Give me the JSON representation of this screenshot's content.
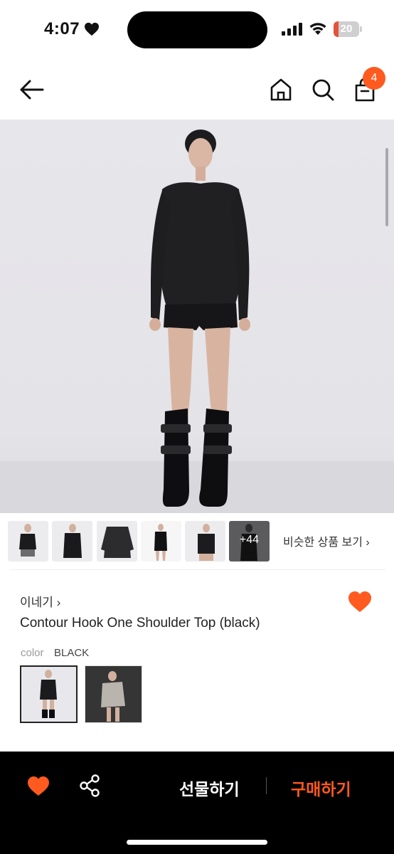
{
  "status": {
    "time": "4:07",
    "battery_level": "20",
    "battery_fraction": 0.2
  },
  "header": {
    "cart_count": "4",
    "icons": [
      "back-arrow-icon",
      "home-icon",
      "search-icon",
      "shopping-bag-icon"
    ]
  },
  "gallery": {
    "thumbnail_count_visible": 6,
    "more_label": "+44",
    "similar_label": "비슷한 상품 보기 ›"
  },
  "product": {
    "brand": "이네기 ›",
    "name": "Contour Hook One Shoulder Top (black)",
    "color_label": "color",
    "color_value": "BLACK",
    "wishlisted": true
  },
  "bottom_bar": {
    "gift_label": "선물하기",
    "buy_label": "구매하기"
  },
  "colors": {
    "accent": "#ff5a1f",
    "bar_background": "#000000",
    "hero_background": "#e7e6eb"
  }
}
